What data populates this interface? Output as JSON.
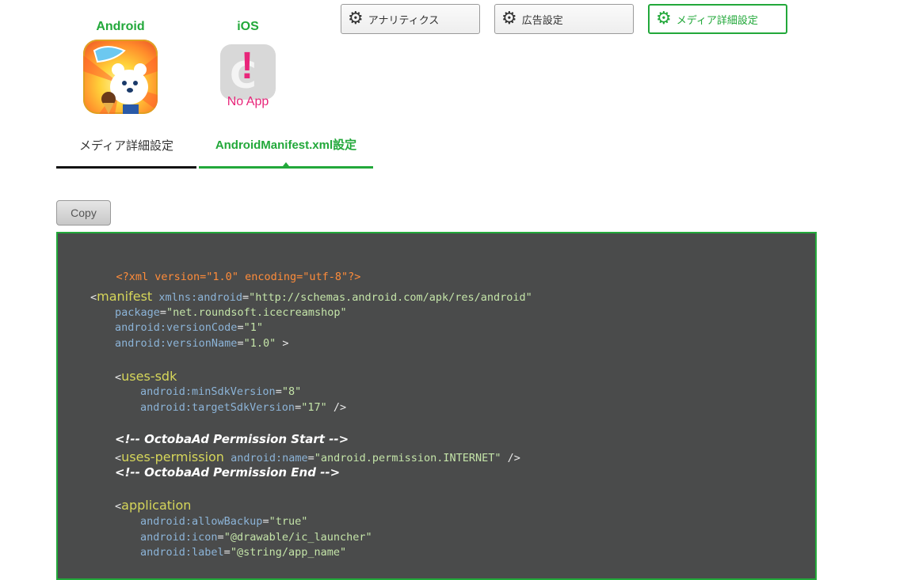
{
  "platforms": {
    "android": {
      "label": "Android",
      "icon": "android-app-icon"
    },
    "ios": {
      "label": "iOS",
      "no_app_text": "No App",
      "icon": "no-app-icon"
    }
  },
  "top_buttons": [
    {
      "label": "アナリティクス",
      "icon": "gear-icon"
    },
    {
      "label": "広告設定",
      "icon": "gear-icon"
    },
    {
      "label": "メディア詳細設定",
      "icon": "gear-icon",
      "active": true
    }
  ],
  "tabs": [
    {
      "label": "メディア詳細設定"
    },
    {
      "label": "AndroidManifest.xml設定",
      "active": true
    }
  ],
  "copy_button": "Copy",
  "code": {
    "decl": "<?xml version=\"1.0\" encoding=\"utf-8\"?>",
    "l_manifest_open": "<",
    "l_manifest_tag": "manifest",
    "l_manifest_attr": "xmlns:android",
    "l_manifest_val": "\"http://schemas.android.com/apk/res/android\"",
    "l_package_attr": "package",
    "l_package_val": "\"net.roundsoft.icecreamshop\"",
    "l_vcode_attr": "android:versionCode",
    "l_vcode_val": "\"1\"",
    "l_vname_attr": "android:versionName",
    "l_vname_val": "\"1.0\"",
    "l_vname_end": " >",
    "l_usessdk_open": "<",
    "l_usessdk_tag": "uses-sdk",
    "l_minsdk_attr": "android:minSdkVersion",
    "l_minsdk_val": "\"8\"",
    "l_targetsdk_attr": "android:targetSdkVersion",
    "l_targetsdk_val": "\"17\"",
    "l_targetsdk_end": " />",
    "comment_start": "<!-- OctobaAd Permission Start -->",
    "l_perm_open": "<",
    "l_perm_tag": "uses-permission",
    "l_perm_attr": "android:name",
    "l_perm_val": "\"android.permission.INTERNET\"",
    "l_perm_end": " />",
    "comment_end": "<!-- OctobaAd Permission End -->",
    "l_app_open": "<",
    "l_app_tag": "application",
    "l_backup_attr": "android:allowBackup",
    "l_backup_val": "\"true\"",
    "l_icon_attr": "android:icon",
    "l_icon_val": "\"@drawable/ic_launcher\"",
    "l_label_attr": "android:label",
    "l_label_val": "\"@string/app_name\"",
    "eq": "="
  },
  "colors": {
    "accent": "#22a83a",
    "code_bg": "#4a4b4b",
    "no_app": "#e8267a"
  }
}
